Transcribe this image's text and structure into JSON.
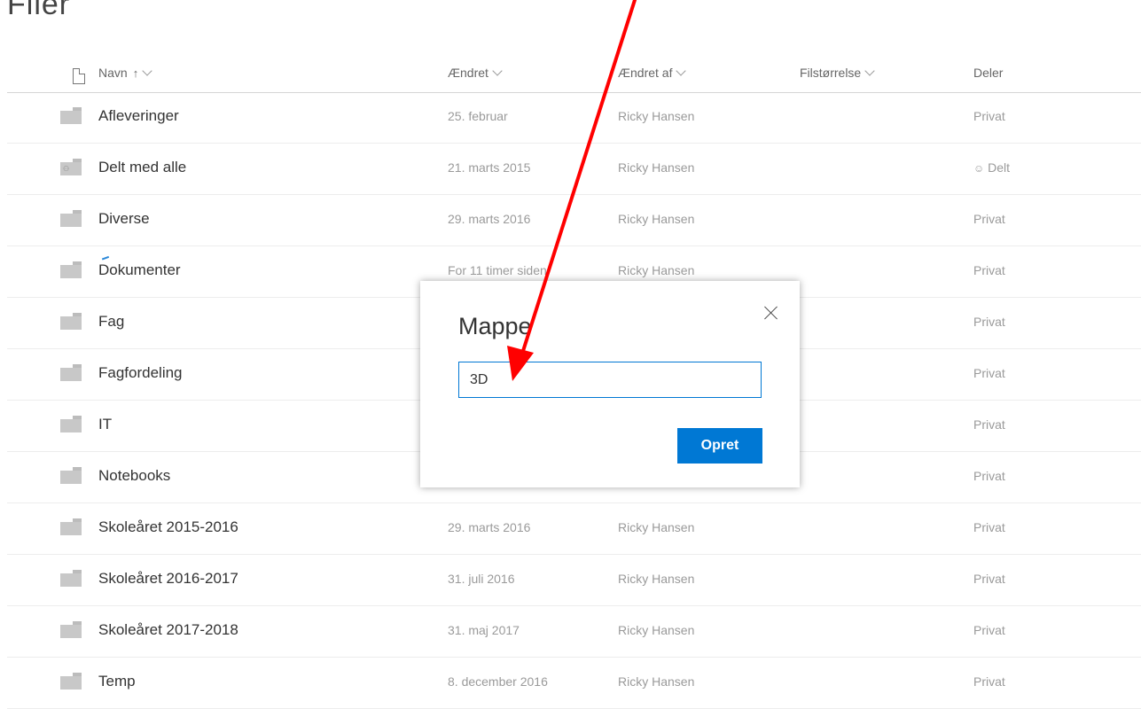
{
  "page": {
    "title": "Filer"
  },
  "columns": {
    "name": "Navn",
    "sort_arrow": "↑",
    "modified": "Ændret",
    "modified_by": "Ændret af",
    "file_size": "Filstørrelse",
    "sharing": "Deler"
  },
  "rows": [
    {
      "name": "Afleveringer",
      "modified": "25. februar",
      "modified_by": "Ricky Hansen",
      "sharing": "Privat",
      "icon": "folder-icon"
    },
    {
      "name": "Delt med alle",
      "modified": "21. marts 2015",
      "modified_by": "Ricky Hansen",
      "sharing": "Delt",
      "icon": "shared-folder-icon"
    },
    {
      "name": "Diverse",
      "modified": "29. marts 2016",
      "modified_by": "Ricky Hansen",
      "sharing": "Privat",
      "icon": "folder-icon"
    },
    {
      "name": "Dokumenter",
      "modified": "For 11 timer siden",
      "modified_by": "Ricky Hansen",
      "sharing": "Privat",
      "icon": "folder-icon"
    },
    {
      "name": "Fag",
      "modified": "",
      "modified_by": "",
      "sharing": "Privat",
      "icon": "folder-icon"
    },
    {
      "name": "Fagfordeling",
      "modified": "",
      "modified_by": "",
      "sharing": "Privat",
      "icon": "folder-icon"
    },
    {
      "name": "IT",
      "modified": "",
      "modified_by": "",
      "sharing": "Privat",
      "icon": "folder-icon"
    },
    {
      "name": "Notebooks",
      "modified": "",
      "modified_by": "",
      "sharing": "Privat",
      "icon": "folder-icon"
    },
    {
      "name": "Skoleåret 2015-2016",
      "modified": "29. marts 2016",
      "modified_by": "Ricky Hansen",
      "sharing": "Privat",
      "icon": "folder-icon"
    },
    {
      "name": "Skoleåret 2016-2017",
      "modified": "31. juli 2016",
      "modified_by": "Ricky Hansen",
      "sharing": "Privat",
      "icon": "folder-icon"
    },
    {
      "name": "Skoleåret 2017-2018",
      "modified": "31. maj 2017",
      "modified_by": "Ricky Hansen",
      "sharing": "Privat",
      "icon": "folder-icon"
    },
    {
      "name": "Temp",
      "modified": "8. december 2016",
      "modified_by": "Ricky Hansen",
      "sharing": "Privat",
      "icon": "folder-icon"
    }
  ],
  "dialog": {
    "title": "Mappe",
    "input_value": "3D",
    "create_label": "Opret"
  },
  "colors": {
    "accent": "#0078d4",
    "annotation_arrow": "#ff0000"
  }
}
